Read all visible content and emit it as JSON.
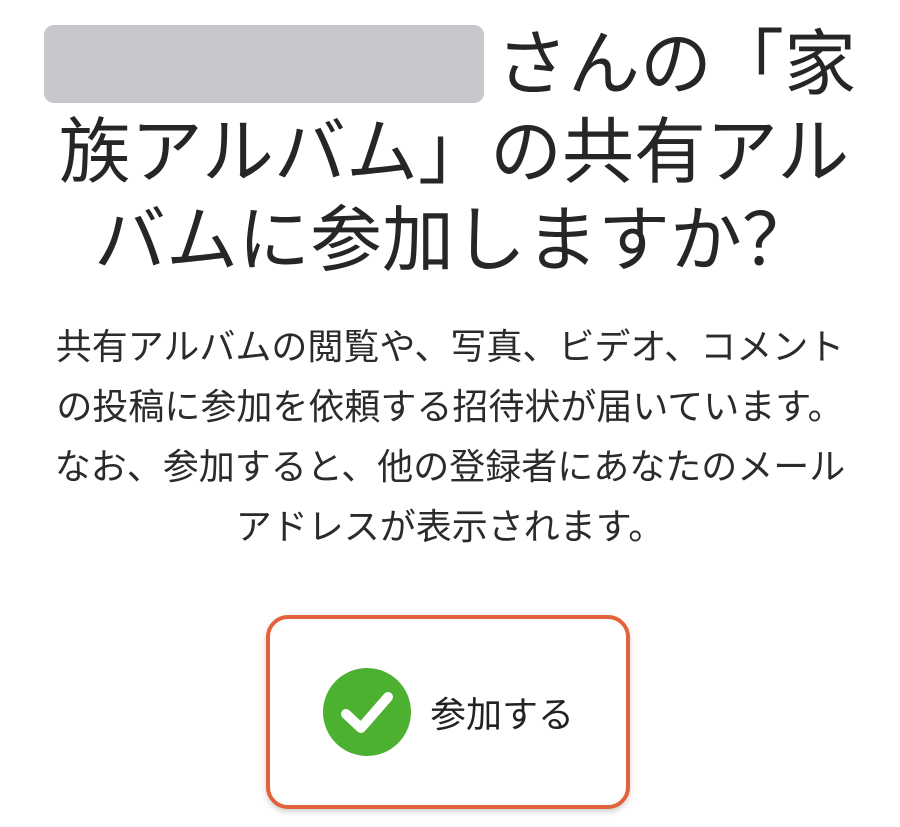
{
  "dialog": {
    "title": {
      "line1_suffix": "さんの「家",
      "line2": "族アルバム」の共有アル",
      "line3": "バムに参加しますか？"
    },
    "description": {
      "lines": [
        "共有アルバムの閲覧や、写真、ビデオ、コメント",
        "の投稿に参加を依頼する招待状が届いています。",
        "なお、参加すると、他の登録者にあなたのメール",
        "アドレスが表示されます。"
      ]
    },
    "join_button": {
      "label": "参加する",
      "icon": "checkmark-circle-icon",
      "icon_color": "#4cb131",
      "highlight_color": "#e2633b"
    },
    "redacted_color": "#c8c7cd"
  }
}
